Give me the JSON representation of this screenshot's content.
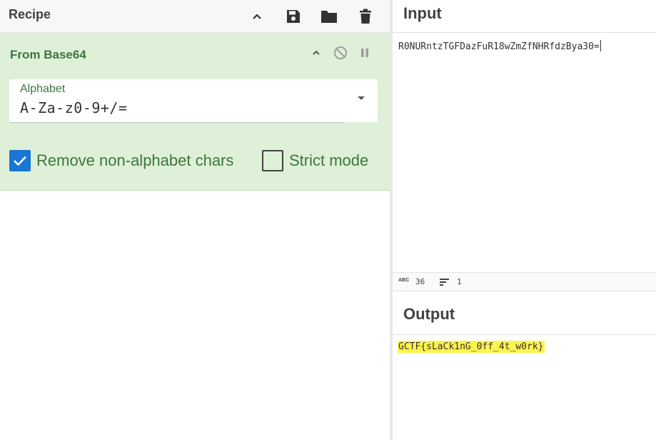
{
  "recipe": {
    "title": "Recipe",
    "header_icons": [
      "chevron-up-icon",
      "save-icon",
      "folder-icon",
      "trash-icon"
    ],
    "operation": {
      "name": "From Base64",
      "controls": [
        "chevron-up-icon",
        "disable-icon",
        "pause-icon"
      ],
      "alphabet": {
        "label": "Alphabet",
        "value": "A-Za-z0-9+/="
      },
      "checkboxes": [
        {
          "label": "Remove non-alphabet chars",
          "checked": true
        },
        {
          "label": "Strict mode",
          "checked": false
        }
      ]
    }
  },
  "input": {
    "title": "Input",
    "value": "R0NURntzTGFDazFuR18wZmZfNHRfdzBya30=",
    "status": {
      "char_count": "36",
      "line_count": "1"
    }
  },
  "output": {
    "title": "Output",
    "value": "GCTF{sLaCk1nG_0ff_4t_w0rk}"
  },
  "colors": {
    "operation_bg": "#dff0d8",
    "operation_text": "#3c763d",
    "checkbox_checked": "#1976d2",
    "output_highlight": "#fff34d"
  }
}
